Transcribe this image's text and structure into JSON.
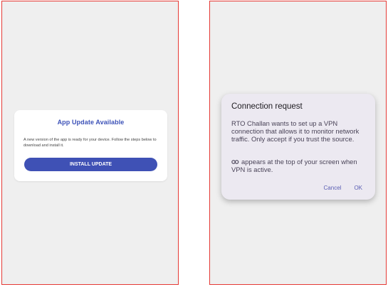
{
  "left_screen": {
    "update_card": {
      "title": "App Update Available",
      "body": "A new version of the app is ready for your device. Follow the steps below to download and install it.",
      "install_button": "INSTALL UPDATE"
    }
  },
  "right_screen": {
    "vpn_dialog": {
      "title": "Connection request",
      "body": "RTO Challan wants to set up a VPN connection that allows it to monitor network traffic. Only accept if you trust the source.",
      "note_icon": "vpn-key-icon",
      "note": "appears at the top of your screen when VPN is active.",
      "cancel_button": "Cancel",
      "ok_button": "OK"
    }
  },
  "colors": {
    "screen_background": "#efefef",
    "frame_border": "#e53935",
    "accent_blue": "#3f51b5",
    "dialog_background": "#ece9f1",
    "dialog_button_text": "#5b5fb4"
  }
}
